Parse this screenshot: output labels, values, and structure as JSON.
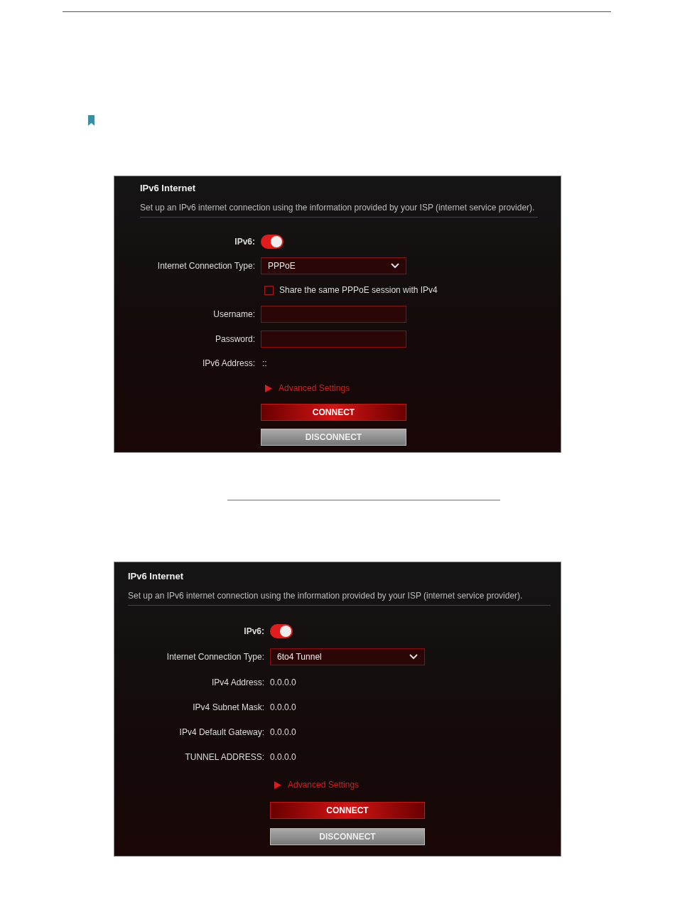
{
  "panels": [
    {
      "title": "IPv6 Internet",
      "description": "Set up an IPv6 internet connection using the information provided by your ISP (internet service provider).",
      "rows": [
        {
          "kind": "toggle",
          "label": "IPv6:",
          "on": true
        },
        {
          "kind": "select",
          "label": "Internet Connection Type:",
          "value": "PPPoE"
        },
        {
          "kind": "checkbox",
          "text": "Share the same PPPoE session with IPv4",
          "checked": false
        },
        {
          "kind": "field",
          "label": "Username:"
        },
        {
          "kind": "field",
          "label": "Password:"
        },
        {
          "kind": "info",
          "label": "IPv6 Address:",
          "value": "::"
        }
      ],
      "advanced": {
        "label": "Advanced Settings",
        "expanded": false
      },
      "buttons": [
        {
          "kind": "primary",
          "label": "CONNECT"
        },
        {
          "kind": "secondary",
          "label": "DISCONNECT"
        }
      ]
    },
    {
      "title": "IPv6 Internet",
      "description": "Set up an IPv6 internet connection using the information provided by your ISP (internet service provider).",
      "rows": [
        {
          "kind": "toggle",
          "label": "IPv6:",
          "on": true
        },
        {
          "kind": "select",
          "label": "Internet Connection Type:",
          "value": "6to4 Tunnel"
        },
        {
          "kind": "info",
          "label": "IPv4 Address:",
          "value": "0.0.0.0"
        },
        {
          "kind": "info",
          "label": "IPv4 Subnet Mask:",
          "value": "0.0.0.0"
        },
        {
          "kind": "info",
          "label": "IPv4 Default Gateway:",
          "value": "0.0.0.0"
        },
        {
          "kind": "info",
          "label": "TUNNEL ADDRESS:",
          "value": "0.0.0.0"
        }
      ],
      "advanced": {
        "label": "Advanced Settings",
        "expanded": false
      },
      "buttons": [
        {
          "kind": "primary",
          "label": "CONNECT"
        },
        {
          "kind": "secondary",
          "label": "DISCONNECT"
        }
      ]
    }
  ]
}
